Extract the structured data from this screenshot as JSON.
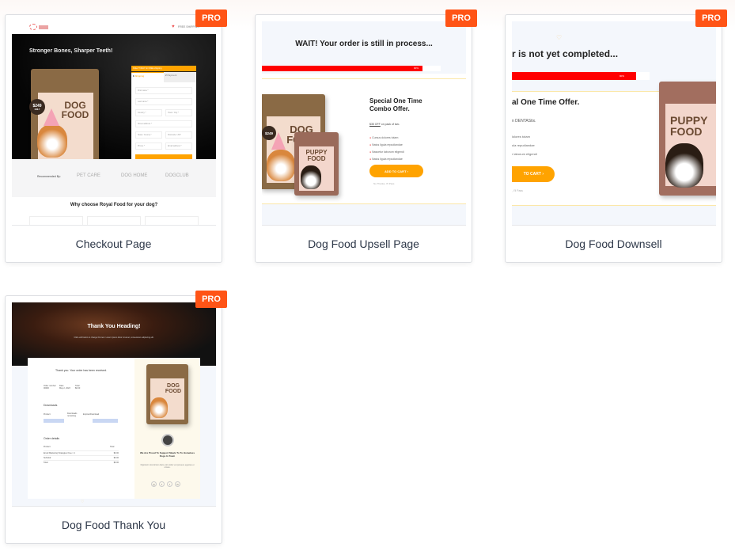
{
  "badge": "PRO",
  "colors": {
    "badge": "#ff5416",
    "accent_orange": "#ffa300",
    "progress_red": "#ff0000"
  },
  "cards": [
    {
      "label": "Checkout Page",
      "preview": {
        "top_link": "FREE SHIPPING",
        "headline": "Stronger Bones, Sharper Teeth!",
        "bag_title_1": "DOG",
        "bag_title_2": "FOOD",
        "price": "$249",
        "price_sub": "ONLY",
        "form_banner": "Order TODAY for FREE shipping",
        "step1_num": "1",
        "step1_label": "Shipping",
        "step2_num": "2",
        "step2_label": "Payment",
        "fields": [
          "First name *",
          "Last name *",
          "Country *",
          "Town / City *",
          "Street address *",
          "State / County *",
          "Postcode / ZIP",
          "Phone *",
          "Email address *"
        ],
        "button": "SHOP NOW",
        "recommended": "Recommended By:",
        "partners": [
          "PET CARE",
          "DOG HOME",
          "DOGCLUB"
        ],
        "why": "Why choose Royal Food for your dog?"
      }
    },
    {
      "label": "Dog Food Upsell Page",
      "preview": {
        "headline": "WAIT! Your order is still in process...",
        "progress_label": "90%",
        "progress": 0.9,
        "offer_title": "Special One Time Combo Offer.",
        "discount": "$35 OFF",
        "discount_tail": " on pack of two.",
        "bullets": [
          "Cursus dolores totam",
          "Natus ligula repudiandae",
          "Nascetur laborum eligendi",
          "Natus ligula repudiandae"
        ],
        "button": "ADD TO CART",
        "decline": "No Thanks, I'll Pass",
        "bag1_title_1": "DOG",
        "bag1_title_2": "FOOD",
        "bag2_title_1": "PUPPY",
        "bag2_title_2": "FOOD",
        "price": "$249"
      }
    },
    {
      "label": "Dog Food Downsell",
      "preview": {
        "headline": "r is not yet completed...",
        "progress_label": "90%",
        "progress": 0.9,
        "offer_title": "al One Time Offer.",
        "subline": "n DENTAStix.",
        "bullets": [
          "lolores totam",
          "ula repudiandae",
          "r laborum eligendi"
        ],
        "button": "TO CART",
        "decline": ", I'll Pass",
        "bag_title_1": "PUPPY",
        "bag_title_2": "FOOD"
      }
    },
    {
      "label": "Dog Food Thank You",
      "preview": {
        "headline": "Thank You Heading!",
        "hero_text": "Click edit button to change this text. Lorem ipsum dolor sit amet, consectetur adipiscing elit.",
        "received": "Thank you. Your order has been received.",
        "meta": [
          [
            "Order number:",
            "00000"
          ],
          [
            "Date:",
            "May 2, 2023"
          ],
          [
            "Total:",
            "$0.00"
          ]
        ],
        "downloads_title": "Downloads",
        "downloads_headers": [
          "Product",
          "Downloads remaining",
          "Expires/Download"
        ],
        "order_details_title": "Order details",
        "order_headers": [
          "Product",
          "Total"
        ],
        "order_rows": [
          [
            "Email Marketing Strategies Free × 1",
            "$0.00"
          ],
          [
            "Subtotal:",
            "$0.00"
          ],
          [
            "Total:",
            "$0.00"
          ]
        ],
        "bag_title_1": "DOG",
        "bag_title_2": "FOOD",
        "support": "We Are Proud To Support Meals To To Homeless Dogs In Town",
        "support_text": "Dignissim nisi dictum diam enim dolor est posuere egestas et ornare.",
        "socials": [
          "instagram",
          "facebook",
          "twitter",
          "google-plus"
        ]
      }
    }
  ]
}
